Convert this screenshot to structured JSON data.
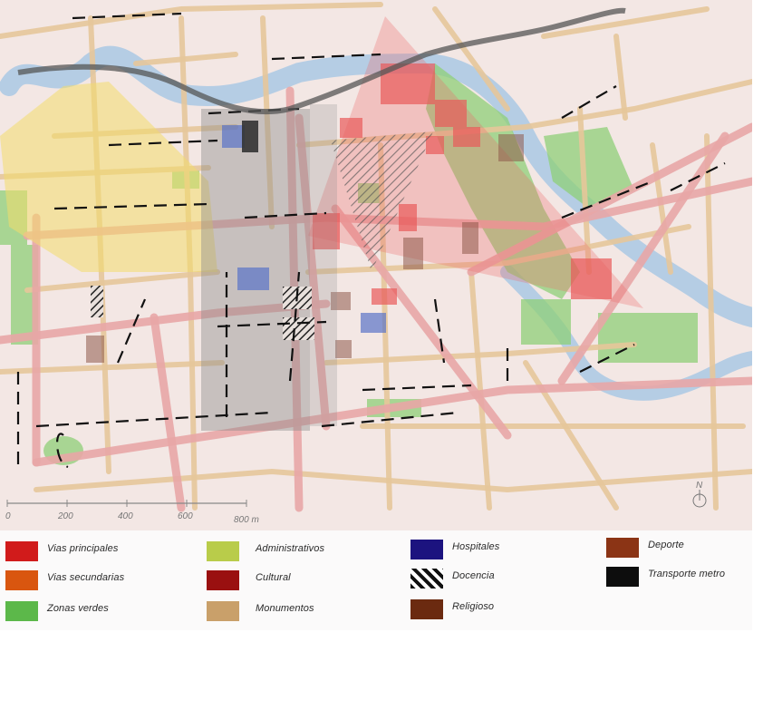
{
  "scale": {
    "ticks": [
      "0",
      "200",
      "400",
      "600",
      "800 m"
    ]
  },
  "north_label": "N",
  "legend": [
    {
      "id": "vias-principales",
      "label": "Vias principales",
      "color": "#d11b1b",
      "pattern": "solid"
    },
    {
      "id": "vias-secundarias",
      "label": "Vias secundarias",
      "color": "#d9560f",
      "pattern": "solid"
    },
    {
      "id": "zonas-verdes",
      "label": "Zonas verdes",
      "color": "#5cb84a",
      "pattern": "solid"
    },
    {
      "id": "administrativos",
      "label": "Administrativos",
      "color": "#b9cc4a",
      "pattern": "solid"
    },
    {
      "id": "cultural",
      "label": "Cultural",
      "color": "#9a1010",
      "pattern": "solid"
    },
    {
      "id": "monumentos",
      "label": "Monumentos",
      "color": "#c9a06a",
      "pattern": "solid"
    },
    {
      "id": "hospitales",
      "label": "Hospitales",
      "color": "#1c137f",
      "pattern": "solid"
    },
    {
      "id": "docencia",
      "label": "Docencia",
      "color": "#111111",
      "pattern": "hatch"
    },
    {
      "id": "religioso",
      "label": "Religioso",
      "color": "#6b2a10",
      "pattern": "solid"
    },
    {
      "id": "deporte",
      "label": "Deporte",
      "color": "#8b3415",
      "pattern": "solid"
    },
    {
      "id": "transporte-metro",
      "label": "Transporte metro",
      "color": "#0d0d0d",
      "pattern": "solid"
    }
  ]
}
